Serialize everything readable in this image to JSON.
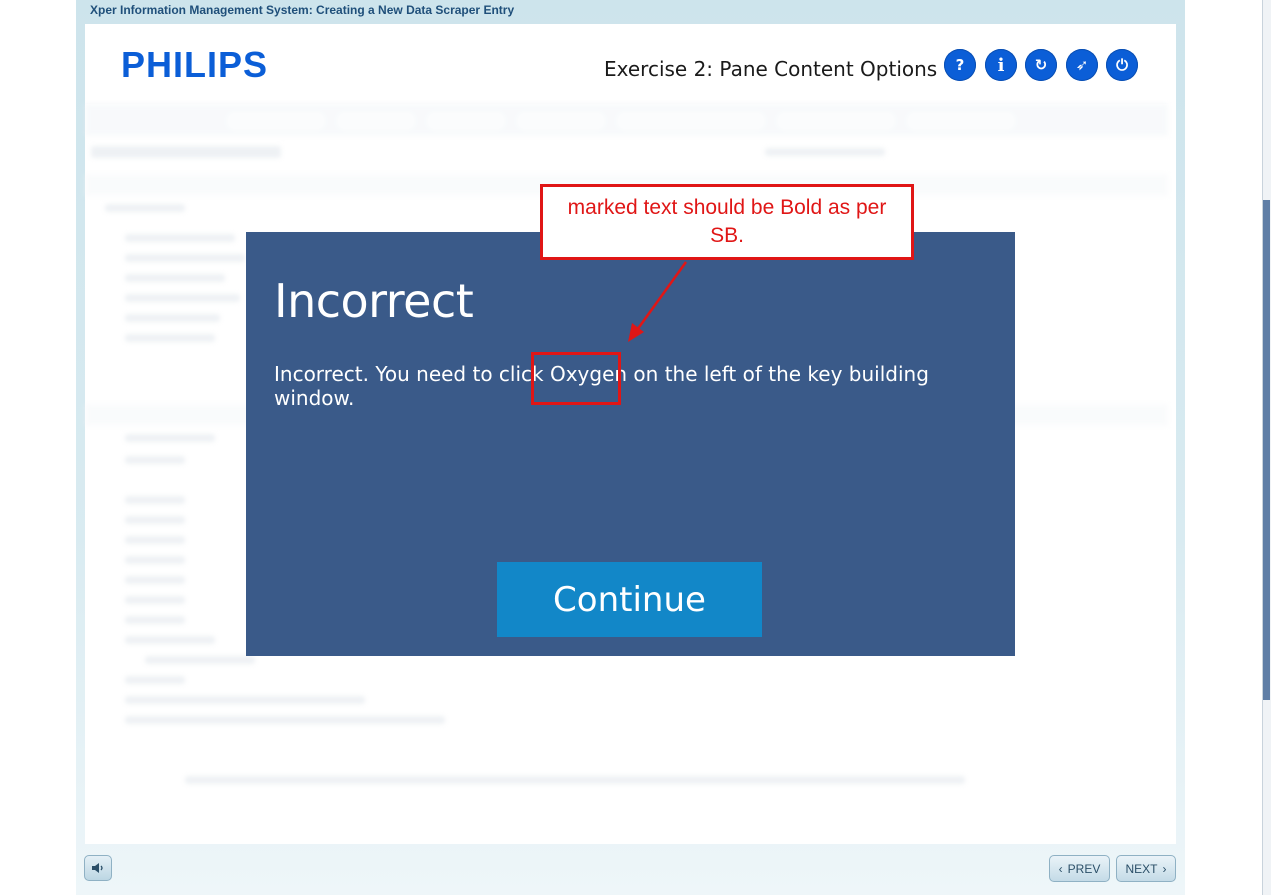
{
  "window": {
    "title": "Xper Information Management System: Creating a New Data Scraper Entry"
  },
  "header": {
    "logo_text": "PHILIPS",
    "exercise_title": "Exercise 2: Pane Content Options",
    "buttons": [
      {
        "name": "help",
        "glyph": "?"
      },
      {
        "name": "info",
        "glyph": "i"
      },
      {
        "name": "replay",
        "glyph": "↻"
      },
      {
        "name": "compass",
        "glyph": "➶"
      },
      {
        "name": "exit",
        "glyph": "⏻"
      }
    ]
  },
  "dialog": {
    "heading": "Incorrect",
    "message_before": "Incorrect. You need to click ",
    "message_highlight": "Oxygen",
    "message_after": " on the left of the key building window.",
    "continue_label": "Continue"
  },
  "annotation": {
    "text": "marked text should be Bold as per SB.",
    "color": "#e01616"
  },
  "footer": {
    "prev_label": "PREV",
    "next_label": "NEXT"
  },
  "colors": {
    "brand_blue": "#0b5ed7",
    "dialog_bg": "#3a5a89",
    "continue_bg": "#1287c8"
  }
}
